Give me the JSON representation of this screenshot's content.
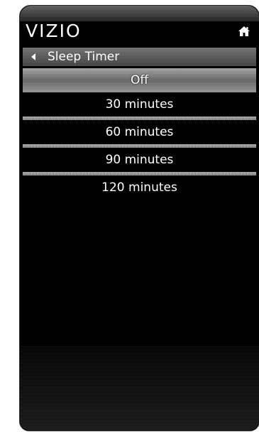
{
  "header": {
    "brand": "VIZIO",
    "home_icon": "home-icon"
  },
  "titlebar": {
    "back_icon": "back-arrow-icon",
    "title": "Sleep Timer"
  },
  "menu": {
    "selected_index": 0,
    "items": [
      {
        "label": "Off"
      },
      {
        "label": "30 minutes"
      },
      {
        "label": "60 minutes"
      },
      {
        "label": "90 minutes"
      },
      {
        "label": "120 minutes"
      }
    ]
  },
  "colors": {
    "background": "#000000",
    "text": "#ffffff",
    "highlight": "#8a8a8a"
  }
}
